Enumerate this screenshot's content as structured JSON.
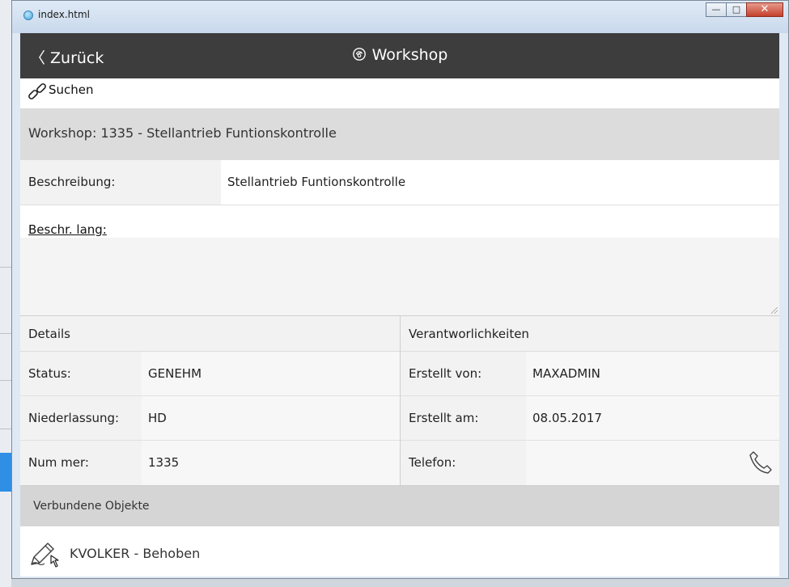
{
  "window": {
    "title": "index.html"
  },
  "nav": {
    "back_label": "Zurück",
    "title": "Workshop"
  },
  "search": {
    "label": "Suchen"
  },
  "workshop": {
    "header": "Workshop: 1335 - Stellantrieb Funtionskontrolle",
    "description_label": "Beschreibung:",
    "description_value": "Stellantrieb Funtionskontrolle",
    "long_description_label": "Beschr. lang:",
    "long_description_value": ""
  },
  "details": {
    "title": "Details",
    "rows": [
      {
        "label": "Status:",
        "value": "GENEHM"
      },
      {
        "label": "Niederlassung:",
        "value": "HD"
      },
      {
        "label": "Num mer:",
        "value": "1335"
      }
    ]
  },
  "responsibilities": {
    "title": "Verantworlichkeiten",
    "rows": [
      {
        "label": "Erstellt von:",
        "value": "MAXADMIN"
      },
      {
        "label": "Erstellt am:",
        "value": "08.05.2017"
      },
      {
        "label": "Telefon:",
        "value": ""
      }
    ]
  },
  "connected": {
    "title": "Verbundene Objekte",
    "items": [
      {
        "label": "KVOLKER - Behoben"
      }
    ]
  }
}
